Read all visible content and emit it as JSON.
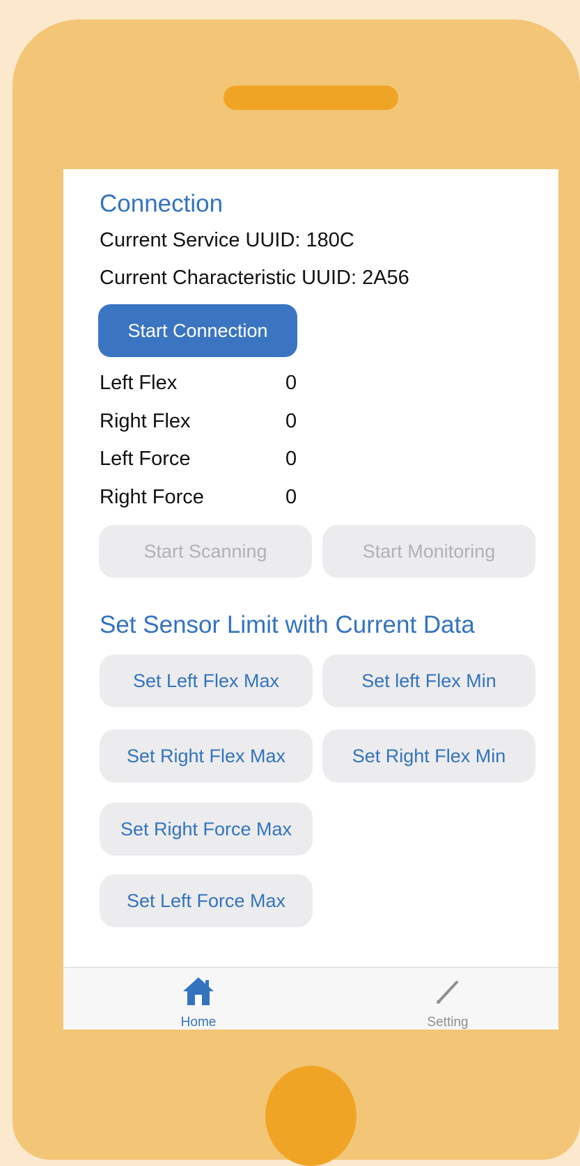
{
  "connection": {
    "title": "Connection",
    "service_uuid": "Current Service UUID: 180C",
    "characteristic_uuid": "Current Characteristic UUID: 2A56",
    "start_button": "Start Connection"
  },
  "readings": [
    {
      "label": "Left Flex",
      "value": "0"
    },
    {
      "label": "Right Flex",
      "value": "0"
    },
    {
      "label": "Left Force",
      "value": "0"
    },
    {
      "label": "Right Force",
      "value": "0"
    }
  ],
  "controls": {
    "scan": "Start Scanning",
    "monitor": "Start Monitoring"
  },
  "limits": {
    "title": "Set Sensor Limit with Current Data",
    "left_flex_max": "Set Left Flex Max",
    "left_flex_min": "Set left Flex Min",
    "right_flex_max": "Set Right Flex Max",
    "right_flex_min": "Set Right Flex Min",
    "right_force_max": "Set Right Force Max",
    "left_force_max": "Set Left Force Max"
  },
  "tabbar": {
    "home": {
      "label": "Home",
      "icon": "house-icon",
      "active": true
    },
    "setting": {
      "label": "Setting",
      "icon": "pencil-icon",
      "active": false
    }
  },
  "colors": {
    "accent": "#3373be",
    "primary_button": "#3b75c1",
    "phone_body": "#f3c576",
    "phone_accent": "#f0a425",
    "background": "#fbe8cd",
    "inactive": "#8e8e93"
  }
}
